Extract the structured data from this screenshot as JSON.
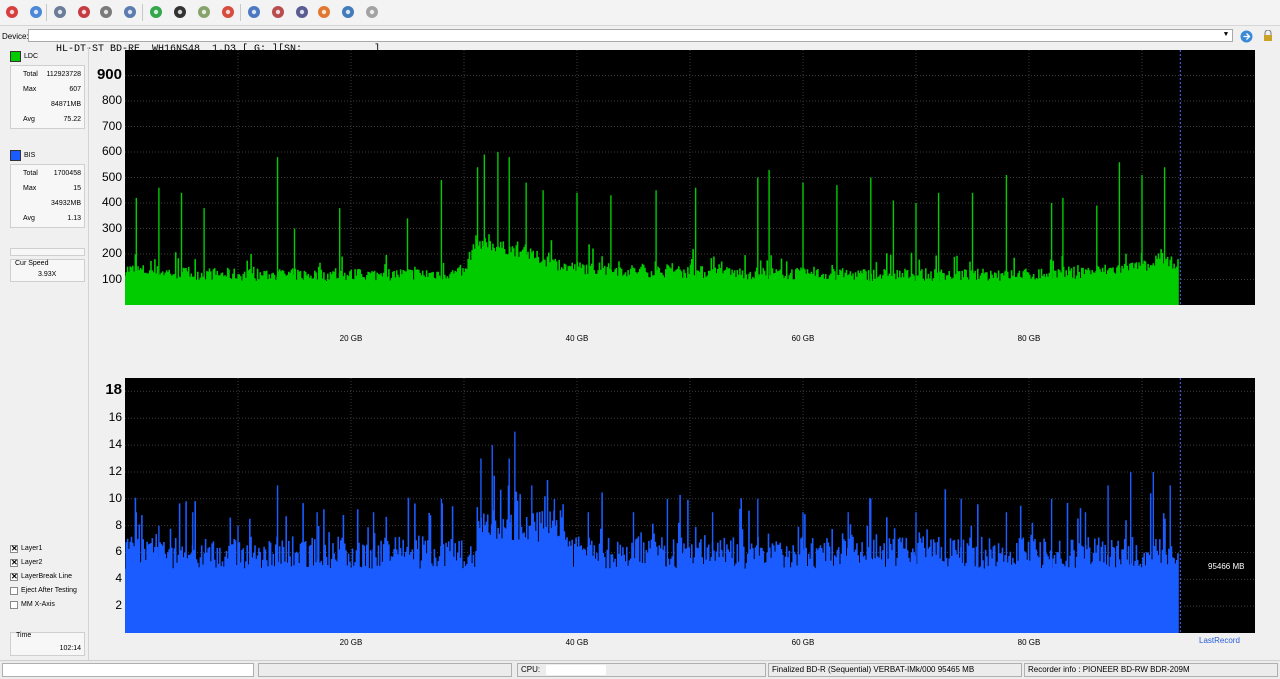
{
  "toolbar": {
    "buttons": [
      {
        "icon": "power-icon",
        "color": "#d42b2b"
      },
      {
        "icon": "wand-icon",
        "color": "#3a7bd5"
      },
      {
        "icon": "drive-info-icon",
        "color": "#5b6f8e"
      },
      {
        "icon": "disc-red-icon",
        "color": "#c0272d"
      },
      {
        "icon": "disc-eject-icon",
        "color": "#6d6d6d"
      },
      {
        "icon": "save-icon",
        "color": "#4b6ea8"
      },
      {
        "icon": "refresh-icon",
        "color": "#1f9e3a"
      },
      {
        "icon": "globe-icon",
        "color": "#1d1d1d"
      },
      {
        "icon": "check-icon",
        "color": "#7a9a5c"
      },
      {
        "icon": "stop-icon",
        "color": "#d43a2a"
      },
      {
        "icon": "info-icon",
        "color": "#3a6bbd"
      },
      {
        "icon": "disc-scan-icon",
        "color": "#b23a3a"
      },
      {
        "icon": "target-icon",
        "color": "#4a4a8a"
      },
      {
        "icon": "flame-icon",
        "color": "#e06a1a"
      },
      {
        "icon": "chart-icon",
        "color": "#2f6fb5"
      },
      {
        "icon": "pin-icon",
        "color": "#9a9a9a"
      }
    ]
  },
  "device": {
    "label": "Device:",
    "value": "HL-DT-ST BD-RE  WH16NS48  1.D3 [ G: ][SN:            ]"
  },
  "ldc": {
    "label": "LDC",
    "color": "#00cc00",
    "total_label": "Total",
    "total": "112923728",
    "max_label": "Max",
    "max": "607",
    "at": "84871MB",
    "avg_label": "Avg",
    "avg": "75.22"
  },
  "bis": {
    "label": "BIS",
    "color": "#1a5cff",
    "total_label": "Total",
    "total": "1700458",
    "max_label": "Max",
    "max": "15",
    "at": "34932MB",
    "avg_label": "Avg",
    "avg": "1.13"
  },
  "speed": {
    "label": "Cur Speed",
    "value": "3.93X"
  },
  "options": {
    "layer1": {
      "label": "Layer1",
      "checked": true
    },
    "layer2": {
      "label": "Layer2",
      "checked": true
    },
    "layerbreak": {
      "label": "LayerBreak Line",
      "checked": true
    },
    "eject": {
      "label": "Eject After Testing",
      "checked": false
    },
    "mm": {
      "label": "MM X-Axis",
      "checked": false
    }
  },
  "time": {
    "label": "Time",
    "value": "102:14"
  },
  "chart_data": [
    {
      "type": "area",
      "series": [
        {
          "name": "LDC"
        }
      ],
      "color": "#00cc00",
      "xlim": [
        0,
        100
      ],
      "x_ticks": [
        "20 GB",
        "40 GB",
        "60 GB",
        "80 GB"
      ],
      "x_tick_values": [
        20,
        40,
        60,
        80
      ],
      "ylim": [
        0,
        1000
      ],
      "y_ticks": [
        "100",
        "200",
        "300",
        "400",
        "500",
        "600",
        "700",
        "800",
        "900"
      ],
      "y_tick_values": [
        100,
        200,
        300,
        400,
        500,
        600,
        700,
        800,
        900
      ],
      "data_end_gb": 93.3,
      "baseline": [
        [
          0,
          140
        ],
        [
          5,
          125
        ],
        [
          10,
          120
        ],
        [
          20,
          118
        ],
        [
          30,
          125
        ],
        [
          31,
          250
        ],
        [
          33,
          230
        ],
        [
          35,
          210
        ],
        [
          37,
          180
        ],
        [
          39,
          150
        ],
        [
          45,
          135
        ],
        [
          55,
          125
        ],
        [
          65,
          120
        ],
        [
          75,
          118
        ],
        [
          80,
          120
        ],
        [
          85,
          130
        ],
        [
          90,
          150
        ],
        [
          93.3,
          170
        ]
      ],
      "spikes": [
        [
          1,
          420
        ],
        [
          3,
          460
        ],
        [
          5,
          440
        ],
        [
          7,
          380
        ],
        [
          13.5,
          580
        ],
        [
          15,
          300
        ],
        [
          19,
          380
        ],
        [
          25,
          340
        ],
        [
          28,
          490
        ],
        [
          31.2,
          540
        ],
        [
          31.8,
          590
        ],
        [
          33,
          600
        ],
        [
          34,
          580
        ],
        [
          35.5,
          480
        ],
        [
          37,
          450
        ],
        [
          40,
          440
        ],
        [
          43,
          430
        ],
        [
          47,
          450
        ],
        [
          50.5,
          460
        ],
        [
          56,
          500
        ],
        [
          57,
          530
        ],
        [
          60,
          480
        ],
        [
          63,
          470
        ],
        [
          66,
          500
        ],
        [
          68,
          410
        ],
        [
          70,
          400
        ],
        [
          72,
          440
        ],
        [
          75,
          440
        ],
        [
          78,
          510
        ],
        [
          82,
          400
        ],
        [
          83,
          420
        ],
        [
          86,
          390
        ],
        [
          88,
          560
        ],
        [
          90,
          510
        ],
        [
          92,
          540
        ]
      ]
    },
    {
      "type": "area",
      "series": [
        {
          "name": "BIS"
        }
      ],
      "color": "#1a5cff",
      "xlim": [
        0,
        100
      ],
      "x_ticks": [
        "20 GB",
        "40 GB",
        "60 GB",
        "80 GB"
      ],
      "x_tick_values": [
        20,
        40,
        60,
        80
      ],
      "ylim": [
        0,
        19
      ],
      "y_ticks": [
        "2",
        "4",
        "6",
        "8",
        "10",
        "12",
        "14",
        "16",
        "18"
      ],
      "y_tick_values": [
        2,
        4,
        6,
        8,
        10,
        12,
        14,
        16,
        18
      ],
      "data_end_gb": 93.3,
      "baseline": [
        [
          0,
          6
        ],
        [
          31,
          6
        ],
        [
          31.1,
          8
        ],
        [
          39,
          8
        ],
        [
          39.5,
          6
        ],
        [
          93.3,
          6
        ]
      ],
      "spikes": [
        [
          1,
          9
        ],
        [
          3,
          8
        ],
        [
          6,
          9
        ],
        [
          10,
          8
        ],
        [
          13.5,
          11
        ],
        [
          17,
          9
        ],
        [
          22,
          9
        ],
        [
          28,
          10
        ],
        [
          31.5,
          13
        ],
        [
          32.5,
          14
        ],
        [
          34,
          13
        ],
        [
          34.5,
          15
        ],
        [
          36,
          11
        ],
        [
          38,
          10
        ],
        [
          41,
          9
        ],
        [
          45,
          9
        ],
        [
          48,
          10
        ],
        [
          52,
          9
        ],
        [
          56,
          10
        ],
        [
          60,
          9
        ],
        [
          64,
          9
        ],
        [
          66,
          10
        ],
        [
          70,
          9
        ],
        [
          74,
          10
        ],
        [
          78,
          9
        ],
        [
          82,
          10
        ],
        [
          85,
          9
        ],
        [
          87,
          11
        ],
        [
          89,
          12
        ],
        [
          91,
          12
        ],
        [
          92.5,
          11
        ]
      ],
      "annotation": "95466 MB",
      "last_label": "LastRecord"
    }
  ],
  "statusbar": {
    "cpu_label": "CPU:",
    "finalized": "Finalized  BD-R (Sequential)  VERBAT-IMk/000  95465 MB",
    "recorder": "Recorder info : PIONEER       BD-RW   BDR-209M"
  }
}
